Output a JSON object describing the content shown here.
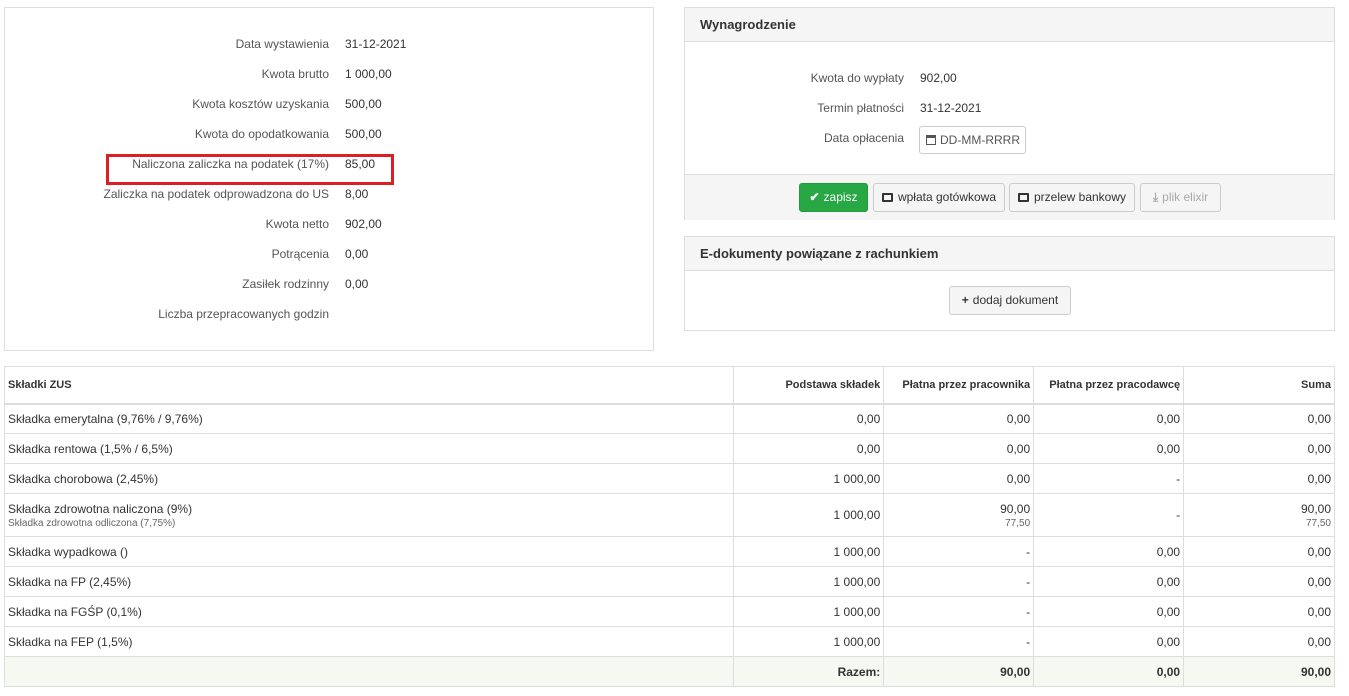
{
  "summary": {
    "rows": [
      {
        "label": "Data wystawienia",
        "value": "31-12-2021"
      },
      {
        "label": "Kwota brutto",
        "value": "1 000,00"
      },
      {
        "label": "Kwota kosztów uzyskania",
        "value": "500,00"
      },
      {
        "label": "Kwota do opodatkowania",
        "value": "500,00"
      },
      {
        "label": "Naliczona zaliczka na podatek (17%)",
        "value": "85,00"
      },
      {
        "label": "Zaliczka na podatek odprowadzona do US",
        "value": "8,00"
      },
      {
        "label": "Kwota netto",
        "value": "902,00"
      },
      {
        "label": "Potrącenia",
        "value": "0,00"
      },
      {
        "label": "Zasiłek rodzinny",
        "value": "0,00"
      },
      {
        "label": "Liczba przepracowanych godzin",
        "value": ""
      }
    ],
    "highlight_color": "#dc1f26"
  },
  "wynagrodzenie": {
    "title": "Wynagrodzenie",
    "kwota_label": "Kwota do wypłaty",
    "kwota_value": "902,00",
    "termin_label": "Termin płatności",
    "termin_value": "31-12-2021",
    "data_label": "Data opłacenia",
    "data_placeholder": "DD-MM-RRRR",
    "buttons": {
      "zapisz": "zapisz",
      "wplata": "wpłata gotówkowa",
      "przelew": "przelew bankowy",
      "elixir": "plik elixir"
    },
    "success_color": "#28a745"
  },
  "edoc": {
    "title": "E-dokumenty powiązane z rachunkiem",
    "add_label": "dodaj dokument"
  },
  "zus": {
    "headers": [
      "Składki ZUS",
      "Podstawa składek",
      "Płatna przez pracownika",
      "Płatna przez pracodawcę",
      "Suma"
    ],
    "rows": [
      {
        "name": "Składka emerytalna (9,76% / 9,76%)",
        "base": "0,00",
        "employee": "0,00",
        "employer": "0,00",
        "sum": "0,00"
      },
      {
        "name": "Składka rentowa (1,5% / 6,5%)",
        "base": "0,00",
        "employee": "0,00",
        "employer": "0,00",
        "sum": "0,00"
      },
      {
        "name": "Składka chorobowa (2,45%)",
        "base": "1 000,00",
        "employee": "0,00",
        "employer": "-",
        "sum": "0,00"
      },
      {
        "name": "Składka zdrowotna naliczona (9%)",
        "sub": "Składka zdrowotna odliczona (7,75%)",
        "base": "1 000,00",
        "employee": "90,00",
        "employee_sub": "77,50",
        "employer": "-",
        "sum": "90,00",
        "sum_sub": "77,50"
      },
      {
        "name": "Składka wypadkowa ()",
        "base": "1 000,00",
        "employee": "-",
        "employer": "0,00",
        "sum": "0,00"
      },
      {
        "name": "Składka na FP (2,45%)",
        "base": "1 000,00",
        "employee": "-",
        "employer": "0,00",
        "sum": "0,00"
      },
      {
        "name": "Składka na FGŚP (0,1%)",
        "base": "1 000,00",
        "employee": "-",
        "employer": "0,00",
        "sum": "0,00"
      },
      {
        "name": "Składka na FEP (1,5%)",
        "base": "1 000,00",
        "employee": "-",
        "employer": "0,00",
        "sum": "0,00"
      }
    ],
    "total": {
      "label": "Razem:",
      "employee": "90,00",
      "employer": "0,00",
      "sum": "90,00"
    }
  }
}
